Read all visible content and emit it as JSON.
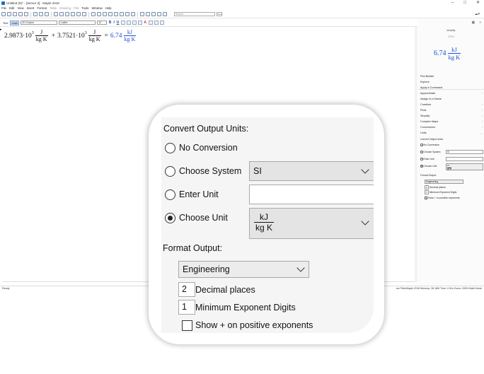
{
  "window": {
    "title": "Untitled (6)* - [Server 3] - Maple 2018",
    "controls": [
      "–",
      "□",
      "✕"
    ]
  },
  "menu": [
    "File",
    "Edit",
    "View",
    "Insert",
    "Format",
    "Table",
    "Drawing",
    "Plot",
    "Tools",
    "Window",
    "Help"
  ],
  "toolbar": {
    "search_placeholder": "Search",
    "search_button": "Alt+A"
  },
  "formatbar": {
    "mode_text": "Text",
    "mode_math": "Math",
    "style": "2D Output",
    "font": "Calibri",
    "size": "12"
  },
  "worksheet": {
    "term1_coef": "2.9873·10",
    "term1_exp": "3",
    "term1_unit_num": "J",
    "term1_unit_den": "kg K",
    "plus": "+",
    "term2_coef": "3.7521·10",
    "term2_exp": "3",
    "term2_unit_num": "J",
    "term2_unit_den": "kg K",
    "equals": "=",
    "result_value": "6.74",
    "result_unit_num": "kJ",
    "result_unit_den": "kg K"
  },
  "status": {
    "left": "Ready",
    "right": "am Files\\Maple 2018   Memory: 36.18M   Time: 2.61s   Zoom: 200%   Math Mode"
  },
  "context_panel": {
    "preview_label": "simplify",
    "preview_sub": "ATSH",
    "preview_value": "6.74",
    "preview_unit_num": "kJ",
    "preview_unit_den": "kg K",
    "items": [
      "Plot Builder",
      "Explore",
      "Apply a Command",
      "Approximate",
      "Assign to a Name",
      "Combine",
      "Plots",
      "Simplify",
      "Complex Maps",
      "Conversions",
      "Units"
    ],
    "convert_heading": "Convert Output Units:",
    "opt_no_conversion": "No Conversion",
    "opt_choose_system": "Choose System",
    "system_value": "SI",
    "opt_enter_unit": "Enter Unit",
    "opt_choose_unit": "Choose Unit",
    "unit_num": "kJ",
    "unit_den": "kg K",
    "format_heading": "Format Output:",
    "format_value": "Engineering",
    "decimal_value": "2",
    "decimal_label": "Decimal places",
    "exponent_value": "1",
    "exponent_label": "Minimum Exponent Digits",
    "show_plus_label": "Show + on positive exponents"
  },
  "zoom": {
    "convert_heading": "Convert Output Units:",
    "opt_no_conversion": "No Conversion",
    "opt_choose_system": "Choose System",
    "system_value": "SI",
    "opt_enter_unit": "Enter Unit",
    "opt_choose_unit": "Choose Unit",
    "unit_num": "kJ",
    "unit_den": "kg K",
    "format_heading": "Format Output:",
    "format_value": "Engineering",
    "decimal_value": "2",
    "decimal_label": "Decimal places",
    "exponent_value": "1",
    "exponent_label": "Minimum Exponent Digits",
    "show_plus_label": "Show + on positive exponents"
  }
}
